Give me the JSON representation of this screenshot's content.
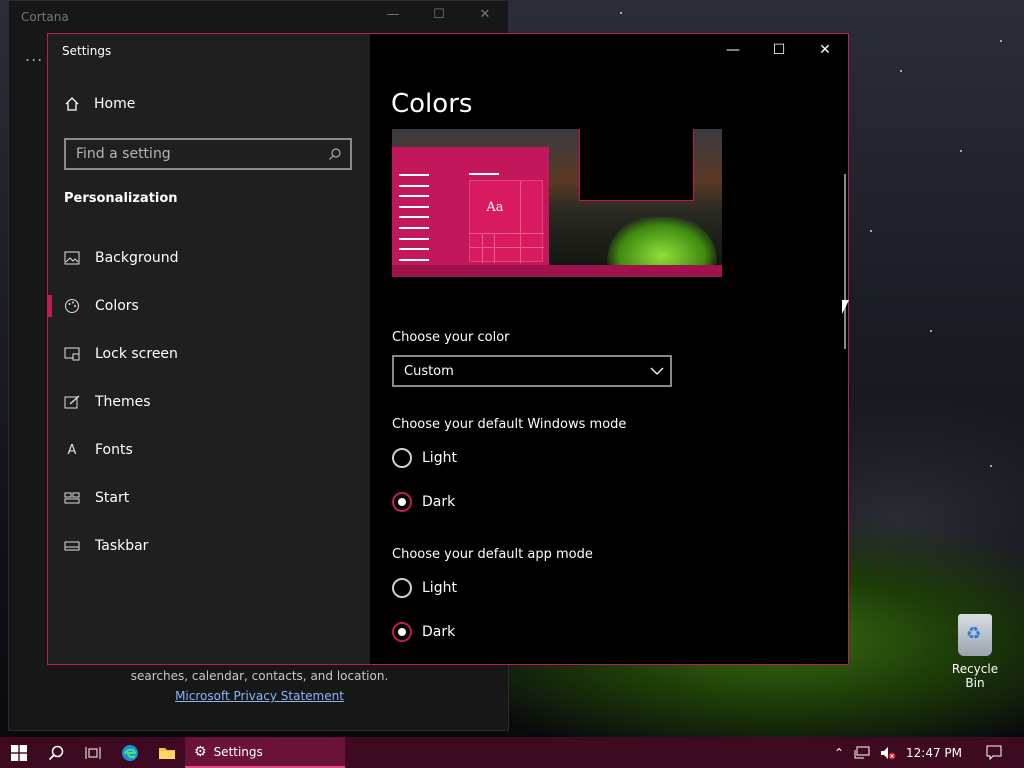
{
  "cortana": {
    "title": "Cortana",
    "dots": "...",
    "text": "searches, calendar, contacts, and location.",
    "privacy_link": "Microsoft Privacy Statement"
  },
  "settings": {
    "window_title": "Settings",
    "home_label": "Home",
    "search_placeholder": "Find a setting",
    "section_title": "Personalization",
    "nav_items": [
      {
        "label": "Background",
        "icon": "picture-icon"
      },
      {
        "label": "Colors",
        "icon": "palette-icon"
      },
      {
        "label": "Lock screen",
        "icon": "lock-screen-icon"
      },
      {
        "label": "Themes",
        "icon": "themes-icon"
      },
      {
        "label": "Fonts",
        "icon": "fonts-icon"
      },
      {
        "label": "Start",
        "icon": "start-icon"
      },
      {
        "label": "Taskbar",
        "icon": "taskbar-icon"
      }
    ],
    "active_item": "Colors"
  },
  "main": {
    "title": "Colors",
    "preview_sample": "Aa",
    "choose_color_label": "Choose your color",
    "choose_color_value": "Custom",
    "windows_mode_label": "Choose your default Windows mode",
    "windows_mode_options": [
      "Light",
      "Dark"
    ],
    "windows_mode_selected": "Dark",
    "app_mode_label": "Choose your default app mode",
    "app_mode_options": [
      "Light",
      "Dark"
    ],
    "app_mode_selected": "Dark"
  },
  "taskbar": {
    "settings_app_label": "Settings",
    "clock": "12:47 PM"
  },
  "desktop": {
    "recycle_bin_label": "Recycle Bin"
  },
  "colors": {
    "accent": "#c01a5a",
    "taskbar": "#3d0a21"
  }
}
